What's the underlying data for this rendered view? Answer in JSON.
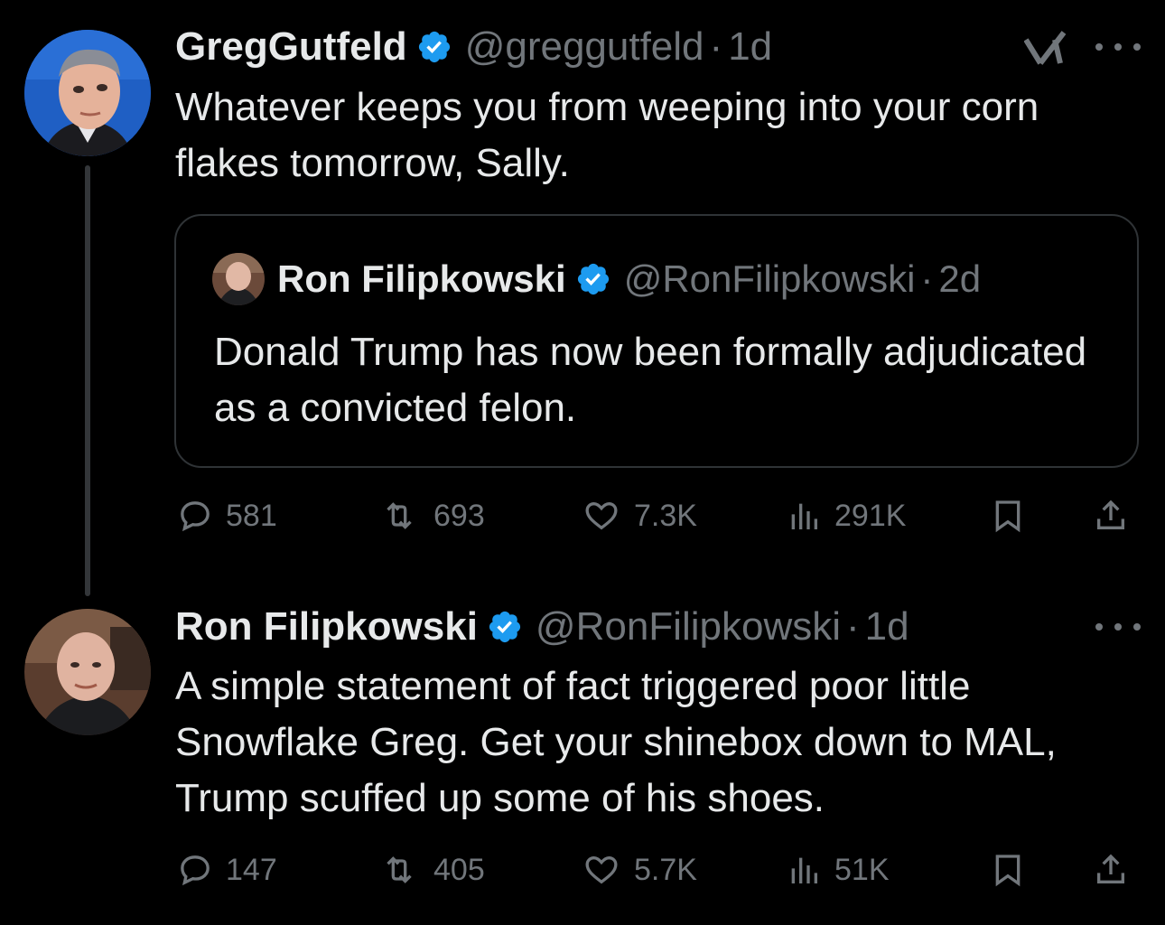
{
  "tweet1": {
    "display_name": "GregGutfeld",
    "handle": "@greggutfeld",
    "separator": "·",
    "time": "1d",
    "text": "Whatever keeps you from weeping into your corn flakes tomorrow, Sally.",
    "stats": {
      "replies": "581",
      "reposts": "693",
      "likes": "7.3K",
      "views": "291K"
    }
  },
  "quote": {
    "display_name": "Ron Filipkowski",
    "handle": "@RonFilipkowski",
    "separator": "·",
    "time": "2d",
    "text": "Donald Trump has now been formally adjudicated as a convicted felon."
  },
  "tweet2": {
    "display_name": "Ron Filipkowski",
    "handle": "@RonFilipkowski",
    "separator": "·",
    "time": "1d",
    "text": "A simple statement of fact triggered poor little Snowflake Greg. Get your shinebox down to MAL, Trump scuffed up some of his shoes.",
    "stats": {
      "replies": "147",
      "reposts": "405",
      "likes": "5.7K",
      "views": "51K"
    }
  },
  "icons": [
    "grok-icon",
    "more-icon",
    "verified-icon",
    "reply-icon",
    "repost-icon",
    "like-icon",
    "views-icon",
    "bookmark-icon",
    "share-icon"
  ],
  "colors": {
    "background": "#000000",
    "text": "#e7e9ea",
    "muted": "#71767b",
    "verified": "#1d9bf0",
    "border": "#2f3336"
  }
}
